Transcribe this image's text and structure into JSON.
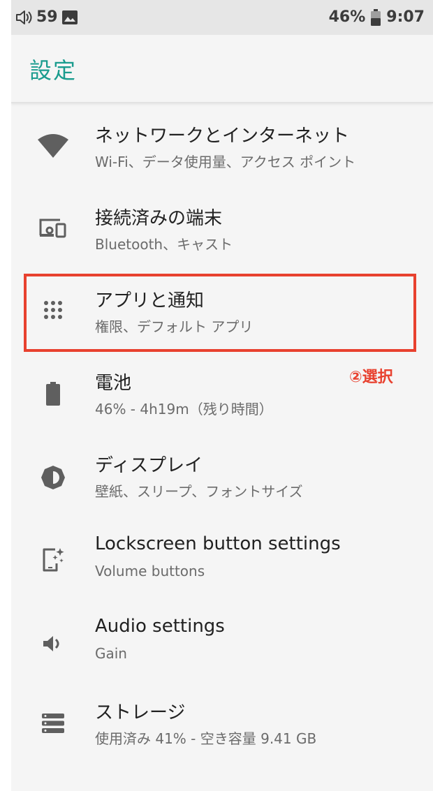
{
  "status_bar": {
    "left_text": "59",
    "battery_percent": "46%",
    "time": "9:07"
  },
  "app_bar": {
    "title": "設定"
  },
  "settings": [
    {
      "title": "ネットワークとインターネット",
      "subtitle": "Wi-Fi、データ使用量、アクセス ポイント",
      "icon": "wifi-icon"
    },
    {
      "title": "接続済みの端末",
      "subtitle": "Bluetooth、キャスト",
      "icon": "devices-icon"
    },
    {
      "title": "アプリと通知",
      "subtitle": "権限、デフォルト アプリ",
      "icon": "apps-icon"
    },
    {
      "title": "電池",
      "subtitle": "46% - 4h19m（残り時間）",
      "icon": "battery-icon"
    },
    {
      "title": "ディスプレイ",
      "subtitle": "壁紙、スリープ、フォントサイズ",
      "icon": "brightness-icon"
    },
    {
      "title": "Lockscreen button settings",
      "subtitle": "Volume buttons",
      "icon": "lockscreen-icon"
    },
    {
      "title": "Audio settings",
      "subtitle": "Gain",
      "icon": "volume-icon"
    },
    {
      "title": "ストレージ",
      "subtitle": "使用済み 41% - 空き容量 9.41 GB",
      "icon": "storage-icon"
    }
  ],
  "annotation": {
    "label": "②選択",
    "color": "#e8412f"
  },
  "colors": {
    "accent": "#1a9c8e",
    "icon": "#5f5f5f"
  }
}
